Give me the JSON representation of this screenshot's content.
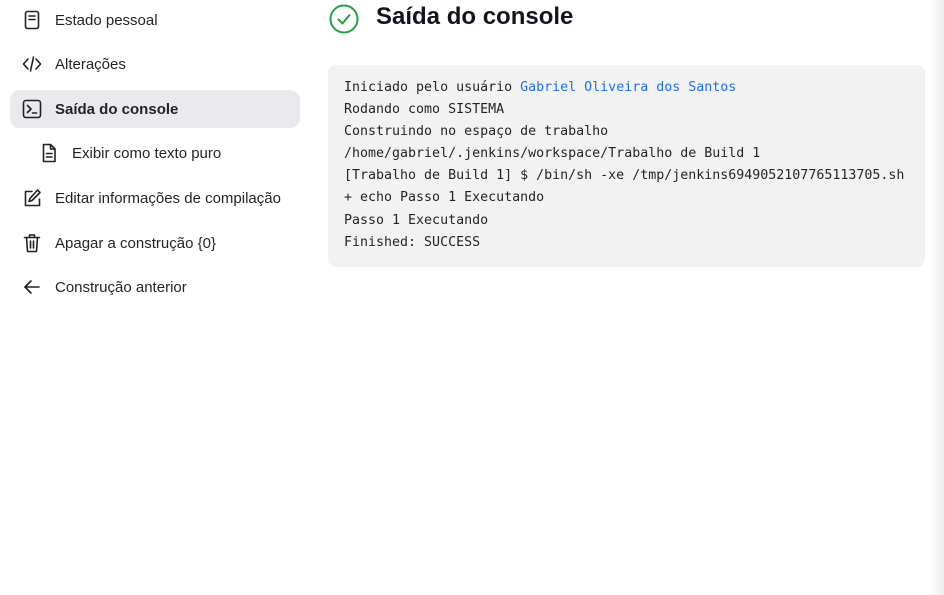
{
  "sidebar": {
    "items": [
      {
        "label": "Estado pessoal",
        "icon": "notepad-icon"
      },
      {
        "label": "Alterações",
        "icon": "code-icon"
      },
      {
        "label": "Saída do console",
        "icon": "terminal-icon",
        "active": true
      },
      {
        "label": "Exibir como texto puro",
        "icon": "document-icon"
      },
      {
        "label": "Editar informações de compilação",
        "icon": "edit-icon"
      },
      {
        "label": "Apagar a construção {0}",
        "icon": "trash-icon"
      },
      {
        "label": "Construção anterior",
        "icon": "arrow-left-icon"
      }
    ]
  },
  "header": {
    "title": "Saída do console",
    "status": "success",
    "status_color": "#1ea446"
  },
  "console": {
    "started_by_prefix": "Iniciado pelo usuário ",
    "started_by_user": "Gabriel Oliveira dos Santos",
    "lines": [
      "Rodando como SISTEMA",
      "Construindo no espaço de trabalho",
      "/home/gabriel/.jenkins/workspace/Trabalho de Build 1",
      "[Trabalho de Build 1] $ /bin/sh -xe /tmp/jenkins6949052107765113705.sh",
      "+ echo Passo 1 Executando",
      "Passo 1 Executando",
      "Finished: SUCCESS"
    ],
    "link_color": "#1f6feb"
  }
}
